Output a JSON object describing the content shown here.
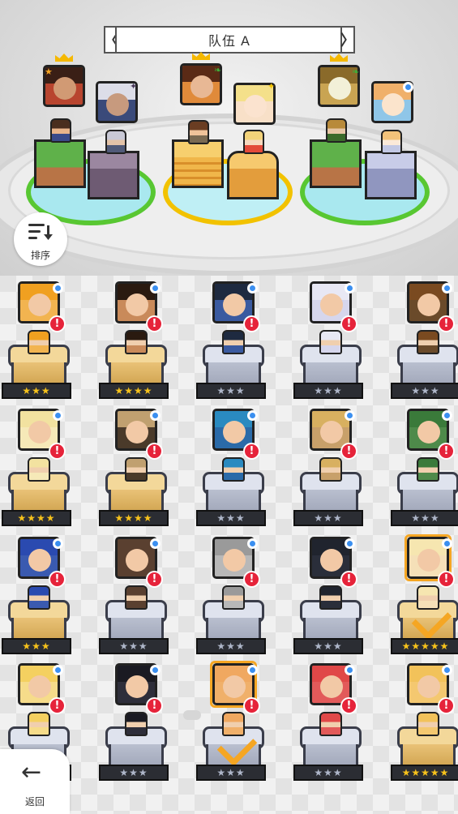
{
  "header": {
    "team_title": "队伍 A",
    "prev_label": "〈",
    "next_label": "〉"
  },
  "controls": {
    "sort_label": "排序",
    "back_label": "返回",
    "back_glyph": "←"
  },
  "team": [
    {
      "slot": 1,
      "frame": "crown",
      "element": "star",
      "base": "grass"
    },
    {
      "slot": 2,
      "frame": "plain",
      "element": "dark",
      "base": "stone"
    },
    {
      "slot": 3,
      "frame": "crown",
      "element": "leaf",
      "base": "cheese"
    },
    {
      "slot": 4,
      "frame": "plain",
      "element": "light",
      "base": "heart"
    },
    {
      "slot": 5,
      "frame": "crown",
      "element": "leaf",
      "base": "grass"
    },
    {
      "slot": 6,
      "frame": "plain",
      "element": "water",
      "base": "snow"
    }
  ],
  "roster_rows": [
    {
      "cards": [
        {
          "stars": "★★★",
          "gold": true,
          "alert": true
        },
        {
          "stars": "★★★★",
          "gold": true,
          "alert": true
        },
        {
          "stars": "★★★",
          "gold": false,
          "alert": true
        },
        {
          "stars": "★★★",
          "gold": false,
          "alert": true
        },
        {
          "stars": "★★★",
          "gold": false,
          "alert": true
        }
      ]
    },
    {
      "cards": [
        {
          "stars": "★★★★",
          "gold": true,
          "alert": true
        },
        {
          "stars": "★★★★",
          "gold": true,
          "alert": true
        },
        {
          "stars": "★★★",
          "gold": false,
          "alert": true
        },
        {
          "stars": "★★★",
          "gold": false,
          "alert": true
        },
        {
          "stars": "★★★",
          "gold": false,
          "alert": true
        }
      ]
    },
    {
      "cards": [
        {
          "stars": "★★★",
          "gold": true,
          "alert": true
        },
        {
          "stars": "★★★",
          "gold": false,
          "alert": true
        },
        {
          "stars": "★★★",
          "gold": false,
          "alert": true
        },
        {
          "stars": "★★★",
          "gold": false,
          "alert": true
        },
        {
          "stars": "★★★★★",
          "gold": true,
          "alert": true,
          "selected": true
        }
      ]
    },
    {
      "cards": [
        {
          "stars": "★★★",
          "gold": false,
          "alert": true
        },
        {
          "stars": "★★★",
          "gold": false,
          "alert": true
        },
        {
          "stars": "★★★",
          "gold": false,
          "alert": true,
          "selected": true
        },
        {
          "stars": "★★★",
          "gold": false,
          "alert": true
        },
        {
          "stars": "★★★★★",
          "gold": true,
          "alert": true
        }
      ]
    }
  ],
  "alert_glyph": "!",
  "colors": {
    "alert": "#e6233a",
    "selected": "#f5a623",
    "pad_green": "#58c732",
    "pad_yellow": "#f2c200",
    "badge": "#3b8ff0"
  }
}
